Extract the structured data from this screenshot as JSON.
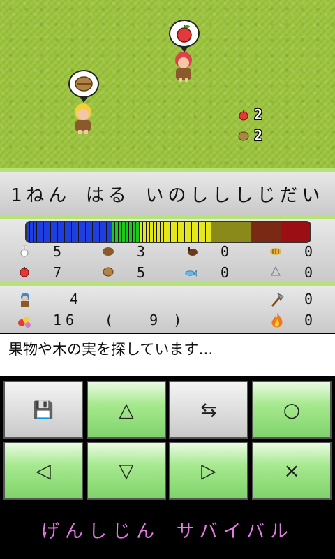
{
  "field": {
    "apple_count": "2",
    "nut_count": "2"
  },
  "date_line": "1ねん  はる  いのしししじだい",
  "gauge": {
    "blue": 0.3,
    "green": 0.1,
    "yellow": 0.25,
    "olive": 0.14,
    "darkred": 0.11,
    "red": 0.1
  },
  "stats": {
    "row1": {
      "rabbit": "5",
      "boar": "3",
      "deer": "0",
      "tiger": "0"
    },
    "row2": {
      "apple": "7",
      "nut": "5",
      "fish": "0",
      "shell": "0"
    }
  },
  "people": {
    "members": "4",
    "tools": "0",
    "food": "16",
    "food_paren_open": "(",
    "food_reserve": "9",
    "food_paren_close": ")",
    "fire": "0"
  },
  "message": "果物や木の実を探しています…",
  "buttons": {
    "save": "💾",
    "up": "△",
    "swap": "⇆",
    "circle": "○",
    "left": "◁",
    "down": "▽",
    "right": "▷",
    "cross": "×"
  },
  "title": "げんしじん  サバイバル"
}
